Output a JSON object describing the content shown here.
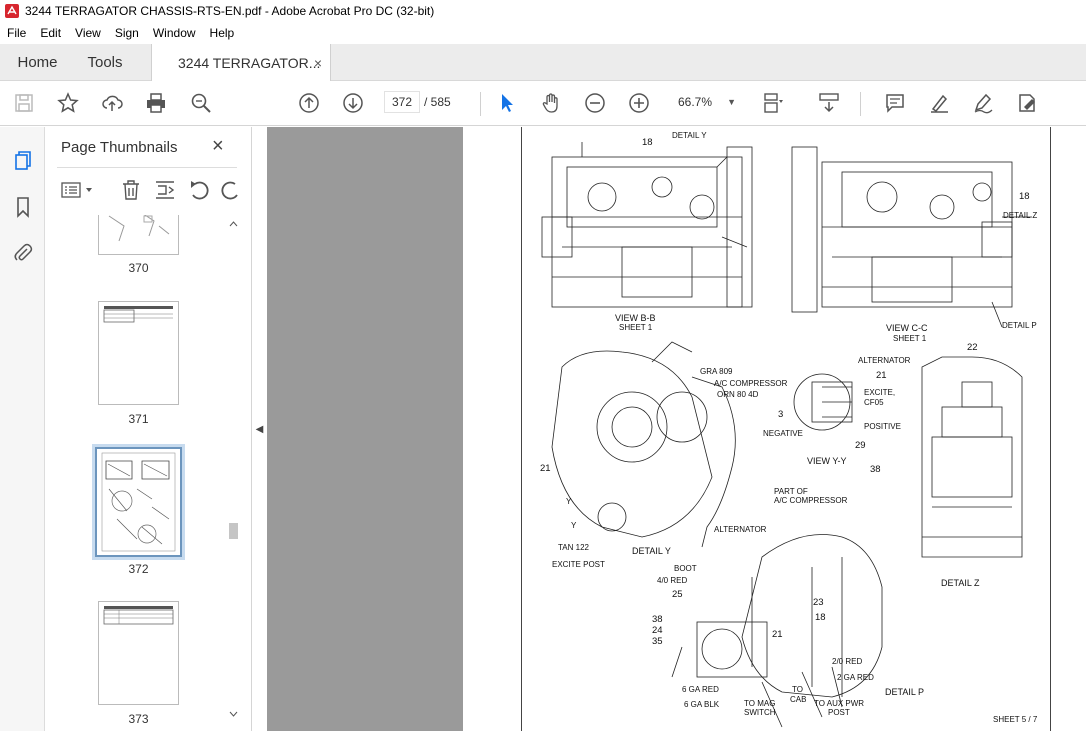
{
  "window": {
    "title": "3244 TERRAGATOR CHASSIS-RTS-EN.pdf - Adobe Acrobat Pro DC (32-bit)"
  },
  "menu": [
    "File",
    "Edit",
    "View",
    "Sign",
    "Window",
    "Help"
  ],
  "tabs": {
    "home": "Home",
    "tools": "Tools",
    "document": "3244 TERRAGATOR...",
    "close": "×"
  },
  "toolbar": {
    "page_current": "372",
    "page_total": "/ 585",
    "zoom": "66.7%"
  },
  "panel": {
    "title": "Page Thumbnails",
    "close": "×",
    "thumbnails": [
      {
        "label": "370"
      },
      {
        "label": "371"
      },
      {
        "label": "372",
        "selected": true
      },
      {
        "label": "373"
      }
    ]
  },
  "drawing": {
    "view_bb": "VIEW B-B",
    "view_bb_sheet": "SHEET 1",
    "view_cc": "VIEW C-C",
    "view_cc_sheet": "SHEET 1",
    "detail_y_top": "DETAIL Y",
    "detail_z_top": "DETAIL Z",
    "detail_p_top": "DETAIL P",
    "n18a": "18",
    "n18b": "18",
    "gra809": "GRA 809",
    "ac_comp": "A/C COMPRESSOR",
    "orn": "ORN 80 4D",
    "n21a": "21",
    "part_of": "PART OF",
    "ac_comp2": "A/C COMPRESSOR",
    "alternator_a": "ALTERNATOR",
    "y1": "Y",
    "y2": "Y",
    "tan122": "TAN 122",
    "detail_y": "DETAIL Y",
    "excite_post": "EXCITE POST",
    "alternator_b": "ALTERNATOR",
    "n21b": "21",
    "excite": "EXCITE,",
    "cf05": "CF05",
    "n3": "3",
    "negative": "NEGATIVE",
    "positive": "POSITIVE",
    "n29": "29",
    "view_yy": "VIEW Y-Y",
    "n22": "22",
    "n38a": "38",
    "detail_z": "DETAIL Z",
    "boot": "BOOT",
    "red40": "4/0 RED",
    "n25": "25",
    "n23": "23",
    "n18c": "18",
    "n21c": "21",
    "n38b": "38",
    "n24": "24",
    "n35": "35",
    "red20": "2/0 RED",
    "red2": "2 GA RED",
    "red6": "6 GA RED",
    "blk6": "6 GA BLK",
    "to_mag": "TO MAG",
    "switch": "SWITCH",
    "to": "TO",
    "cab": "CAB",
    "to_aux": "TO AUX PWR",
    "post": "POST",
    "detail_p": "DETAIL P",
    "sheet": "SHEET 5 / 7"
  },
  "colors": {
    "accent": "#1473e6",
    "app_red": "#d7262e",
    "page_bg": "#9a9a9a"
  }
}
